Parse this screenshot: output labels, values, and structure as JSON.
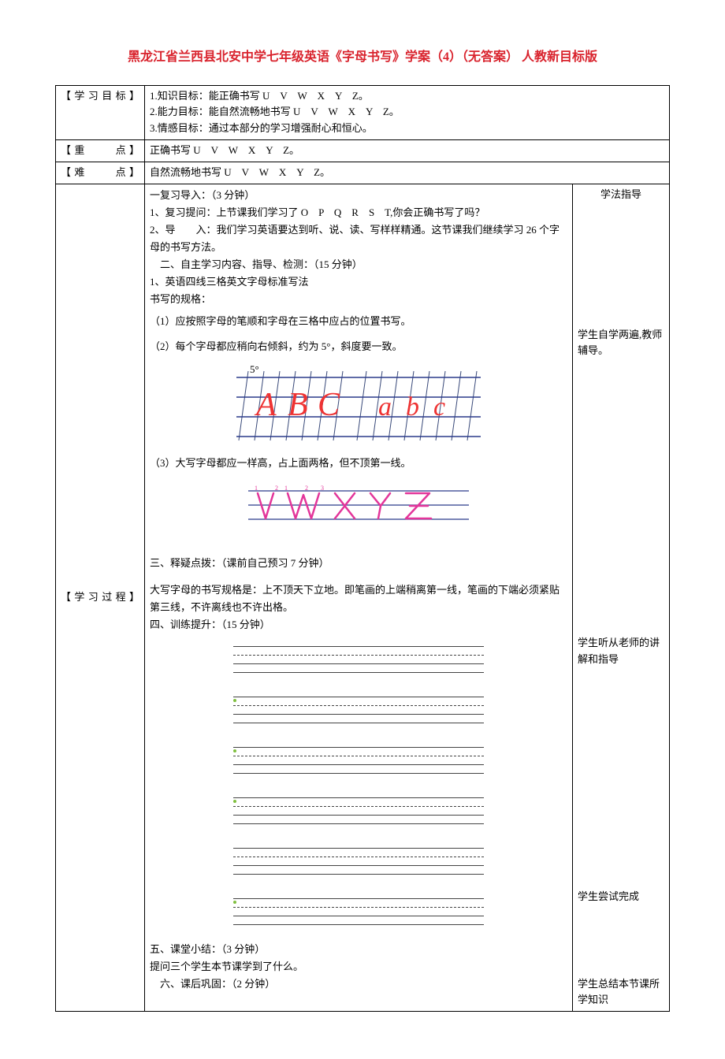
{
  "page_title": "黑龙江省兰西县北安中学七年级英语《字母书写》学案（4）（无答案） 人教新目标版",
  "labels": {
    "learning_goals": "【学习目标】",
    "key_point": "【重　　点】",
    "difficult_point": "【难　　点】",
    "learning_process": "【学习过程】"
  },
  "goals": {
    "g1": "1.知识目标：能正确书写 U　V　W　X　Y　Z。",
    "g2": "2.能力目标：能自然流畅地书写 U　V　W　X　Y　Z。",
    "g3": "3.情感目标：通过本部分的学习增强耐心和恒心。"
  },
  "key_point_text": "正确书写 U　V　W　X　Y　Z。",
  "difficult_point_text": "自然流畅地书写 U　V　W　X　Y　Z。",
  "guidance_header": "学法指导",
  "content": {
    "sec1_title": "一复习导入：（3 分钟）",
    "sec1_line1": "1、复习提问：上节课我们学习了 O　P　Q　R　S　T,你会正确书写了吗？",
    "sec1_line2_a": "2、导　　入：",
    "sec1_line2_b": "我们学习英语要达到听、说、读、写样样精通。这节课我们继续学习 26 个字母的书写方法。",
    "sec2_title": "　二、自主学习内容、指导、检测：（15 分钟）",
    "sec2_line1": "1、英语四线三格英文字母标准写法",
    "sec2_line2": "书写的规格：",
    "rule1": "（1）应按照字母的笔顺和字母在三格中应占的位置书写。",
    "rule2": "（2）每个字母都应稍向右倾斜，约为 5°，斜度要一致。",
    "rule3": "（3）大写字母都应一样高，占上面两格，但不顶第一线。",
    "sec3_title": "三、释疑点拨：（课前自己预习 7 分钟）",
    "sec3_body": "大写字母的书写规格是：上不顶天下立地。即笔画的上端稍离第一线，笔画的下端必须紧贴第三线，不许离线也不许出格。",
    "sec4_title": "四、训练提升：（15 分钟）",
    "sec5_title": "五、课堂小结：（3 分钟）",
    "sec5_body": "提问三个学生本节课学到了什么。",
    "sec6_title": "　六、课后巩固：（2 分钟）"
  },
  "guidance": {
    "g1": "学生自学两遍,教师辅导。",
    "g2": "学生听从老师的讲解和指导",
    "g3": "学生尝试完成",
    "g4": "学生总结本节课所学知识"
  },
  "five_degree": "5°"
}
